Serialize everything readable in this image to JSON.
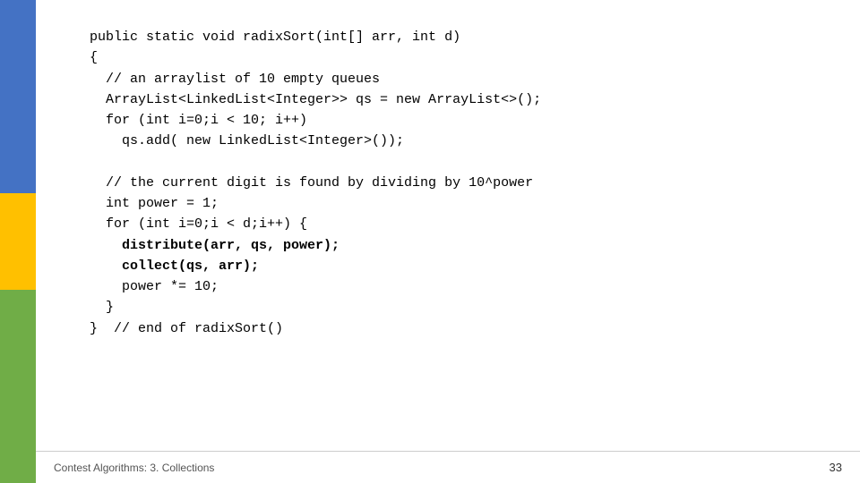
{
  "sidebar": {
    "bars": [
      "blue",
      "yellow",
      "green"
    ]
  },
  "code": {
    "lines": [
      {
        "text": "public static void radixSort(int[] arr, int d)",
        "bold": false
      },
      {
        "text": "{",
        "bold": false
      },
      {
        "text": "  // an arraylist of 10 empty queues",
        "bold": false
      },
      {
        "text": "  ArrayList<LinkedList<Integer>> qs = new ArrayList<>();",
        "bold": false
      },
      {
        "text": "  for (int i=0;i < 10; i++)",
        "bold": false
      },
      {
        "text": "    qs.add( new LinkedList<Integer>());",
        "bold": false
      },
      {
        "text": "",
        "bold": false
      },
      {
        "text": "  // the current digit is found by dividing by 10^power",
        "bold": false
      },
      {
        "text": "  int power = 1;",
        "bold": false
      },
      {
        "text": "  for (int i=0;i < d;i++) {",
        "bold": false
      },
      {
        "text": "    distribute(arr, qs, power);",
        "bold": true
      },
      {
        "text": "    collect(qs, arr);",
        "bold": true
      },
      {
        "text": "    power *= 10;",
        "bold": false
      },
      {
        "text": "  }",
        "bold": false
      },
      {
        "text": "}  // end of radixSort()",
        "bold": false
      }
    ]
  },
  "footer": {
    "title": "Contest Algorithms: 3. Collections",
    "page": "33"
  }
}
